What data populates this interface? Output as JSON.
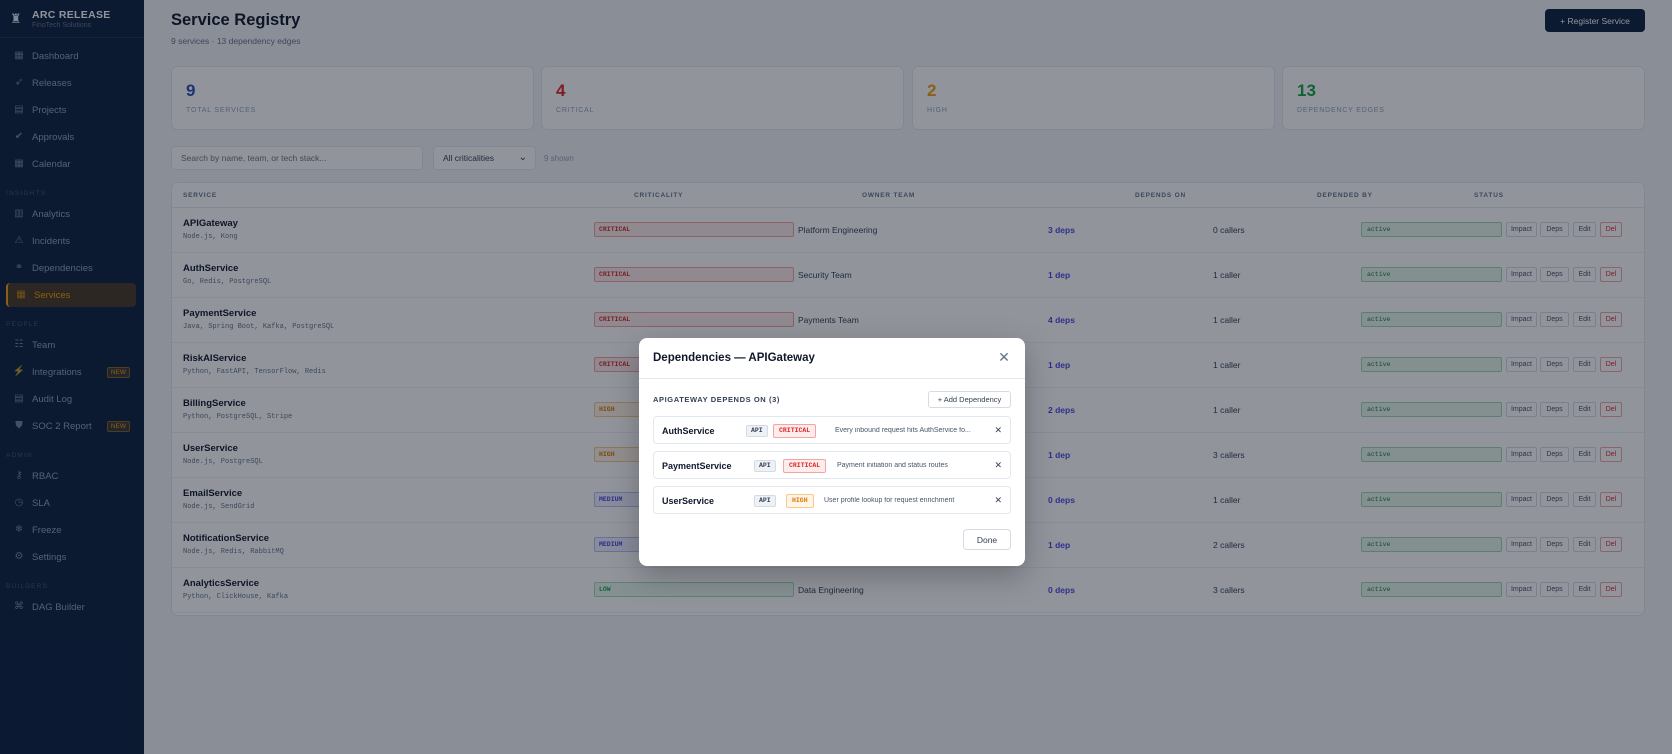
{
  "brand": {
    "title": "ARC RELEASE",
    "subtitle": "FinoTech Solutions"
  },
  "sidebar": {
    "items": [
      {
        "label": "Dashboard",
        "icon": "grid-icon"
      },
      {
        "label": "Releases",
        "icon": "rocket-icon"
      },
      {
        "label": "Projects",
        "icon": "folder-icon"
      },
      {
        "label": "Approvals",
        "icon": "check-icon"
      },
      {
        "label": "Calendar",
        "icon": "calendar-icon"
      },
      {
        "label": "Analytics",
        "icon": "chart-icon"
      },
      {
        "label": "Incidents",
        "icon": "warning-icon"
      },
      {
        "label": "Dependencies",
        "icon": "link-icon"
      },
      {
        "label": "Services",
        "icon": "services-icon",
        "active": true
      },
      {
        "label": "Team",
        "icon": "team-icon"
      },
      {
        "label": "Integrations",
        "icon": "plug-icon",
        "badge": "NEW"
      },
      {
        "label": "Audit Log",
        "icon": "log-icon"
      },
      {
        "label": "SOC 2 Report",
        "icon": "shield-icon",
        "badge": "NEW"
      },
      {
        "label": "RBAC",
        "icon": "key-icon"
      },
      {
        "label": "SLA",
        "icon": "clock-icon"
      },
      {
        "label": "Freeze",
        "icon": "snowflake-icon"
      },
      {
        "label": "Settings",
        "icon": "gear-icon"
      },
      {
        "label": "DAG Builder",
        "icon": "dag-icon"
      }
    ],
    "sections": [
      "INSIGHTS",
      "PEOPLE",
      "ADMIN",
      "BUILDERS"
    ]
  },
  "header": {
    "title": "Service Registry",
    "subtitle": "9 services · 13 dependency edges",
    "register_label": "+ Register Service"
  },
  "stats": [
    {
      "value": "9",
      "label": "TOTAL SERVICES",
      "color": "#2f4fb8"
    },
    {
      "value": "4",
      "label": "CRITICAL",
      "color": "#dc2626"
    },
    {
      "value": "2",
      "label": "HIGH",
      "color": "#f59e0b"
    },
    {
      "value": "13",
      "label": "DEPENDENCY EDGES",
      "color": "#16a34a"
    }
  ],
  "filters": {
    "search_placeholder": "Search by name, team, or tech stack...",
    "criticality_selected": "All criticalities",
    "shown_text": "9 shown"
  },
  "table": {
    "headers": [
      "SERVICE",
      "CRITICALITY",
      "OWNER TEAM",
      "DEPENDS ON",
      "DEPENDED BY",
      "STATUS"
    ],
    "actions": [
      "Impact",
      "Deps",
      "Edit",
      "Del"
    ],
    "rows": [
      {
        "name": "APIGateway",
        "tech": "Node.js, Kong",
        "criticality": "CRITICAL",
        "level": "critical",
        "owner": "Platform Engineering",
        "deps": "3 deps",
        "callers": "0 callers",
        "status": "active"
      },
      {
        "name": "AuthService",
        "tech": "Go, Redis, PostgreSQL",
        "criticality": "CRITICAL",
        "level": "critical",
        "owner": "Security Team",
        "deps": "1 dep",
        "callers": "1 caller",
        "status": "active"
      },
      {
        "name": "PaymentService",
        "tech": "Java, Spring Boot, Kafka, PostgreSQL",
        "criticality": "CRITICAL",
        "level": "critical",
        "owner": "Payments Team",
        "deps": "4 deps",
        "callers": "1 caller",
        "status": "active"
      },
      {
        "name": "RiskAIService",
        "tech": "Python, FastAPI, TensorFlow, Redis",
        "criticality": "CRITICAL",
        "level": "critical",
        "owner": "",
        "deps": "1 dep",
        "callers": "1 caller",
        "status": "active"
      },
      {
        "name": "BillingService",
        "tech": "Python, PostgreSQL, Stripe",
        "criticality": "HIGH",
        "level": "high",
        "owner": "",
        "deps": "2 deps",
        "callers": "1 caller",
        "status": "active"
      },
      {
        "name": "UserService",
        "tech": "Node.js, PostgreSQL",
        "criticality": "HIGH",
        "level": "high",
        "owner": "",
        "deps": "1 dep",
        "callers": "3 callers",
        "status": "active"
      },
      {
        "name": "EmailService",
        "tech": "Node.js, SendGrid",
        "criticality": "MEDIUM",
        "level": "medium",
        "owner": "",
        "deps": "0 deps",
        "callers": "1 caller",
        "status": "active"
      },
      {
        "name": "NotificationService",
        "tech": "Node.js, Redis, RabbitMQ",
        "criticality": "MEDIUM",
        "level": "medium",
        "owner": "",
        "deps": "1 dep",
        "callers": "2 callers",
        "status": "active"
      },
      {
        "name": "AnalyticsService",
        "tech": "Python, ClickHouse, Kafka",
        "criticality": "LOW",
        "level": "low",
        "owner": "Data Engineering",
        "deps": "0 deps",
        "callers": "3 callers",
        "status": "active"
      }
    ]
  },
  "modal": {
    "title": "Dependencies — APIGateway",
    "heading": "APIGATEWAY DEPENDS ON (3)",
    "add_label": "+ Add Dependency",
    "done_label": "Done",
    "deps": [
      {
        "name": "AuthService",
        "type": "API",
        "criticality": "CRITICAL",
        "level": "critical",
        "desc": "Every inbound request hits AuthService fo..."
      },
      {
        "name": "PaymentService",
        "type": "API",
        "criticality": "CRITICAL",
        "level": "critical",
        "desc": "Payment initiation and status routes"
      },
      {
        "name": "UserService",
        "type": "API",
        "criticality": "HIGH",
        "level": "high",
        "desc": "User profile lookup for request enrichment"
      }
    ]
  }
}
